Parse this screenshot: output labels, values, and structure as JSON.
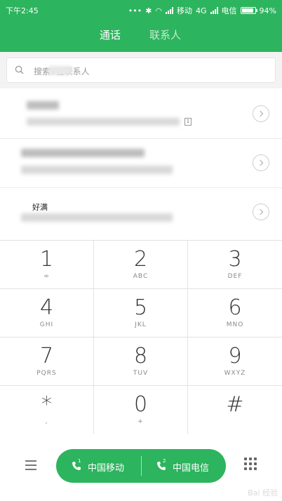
{
  "status_bar": {
    "time": "下午2:45",
    "carrier1": "移动",
    "network": "4G",
    "carrier2": "电信",
    "battery": "94%"
  },
  "tabs": [
    {
      "label": "通话",
      "active": true
    },
    {
      "label": "联系人",
      "active": false
    }
  ],
  "search": {
    "placeholder": "搜索9位联系人"
  },
  "recent_calls": [
    {
      "name": "",
      "sim": "1"
    },
    {
      "name": ""
    },
    {
      "name": "好满"
    }
  ],
  "keypad": [
    {
      "digit": "1",
      "letters": "∞"
    },
    {
      "digit": "2",
      "letters": "ABC"
    },
    {
      "digit": "3",
      "letters": "DEF"
    },
    {
      "digit": "4",
      "letters": "GHI"
    },
    {
      "digit": "5",
      "letters": "JKL"
    },
    {
      "digit": "6",
      "letters": "MNO"
    },
    {
      "digit": "7",
      "letters": "PQRS"
    },
    {
      "digit": "8",
      "letters": "TUV"
    },
    {
      "digit": "9",
      "letters": "WXYZ"
    },
    {
      "digit": "*",
      "letters": ","
    },
    {
      "digit": "0",
      "letters": "+"
    },
    {
      "digit": "#",
      "letters": ""
    }
  ],
  "call_buttons": [
    {
      "label": "中国移动",
      "sim": "1"
    },
    {
      "label": "中国电信",
      "sim": "2"
    }
  ],
  "watermark": "Bai 经验",
  "colors": {
    "accent": "#2db45e"
  },
  "icons": {
    "menu": "menu-icon",
    "search": "search-icon",
    "chevron": "chevron-right-icon",
    "dialpad": "dialpad-icon",
    "phone": "phone-icon"
  }
}
